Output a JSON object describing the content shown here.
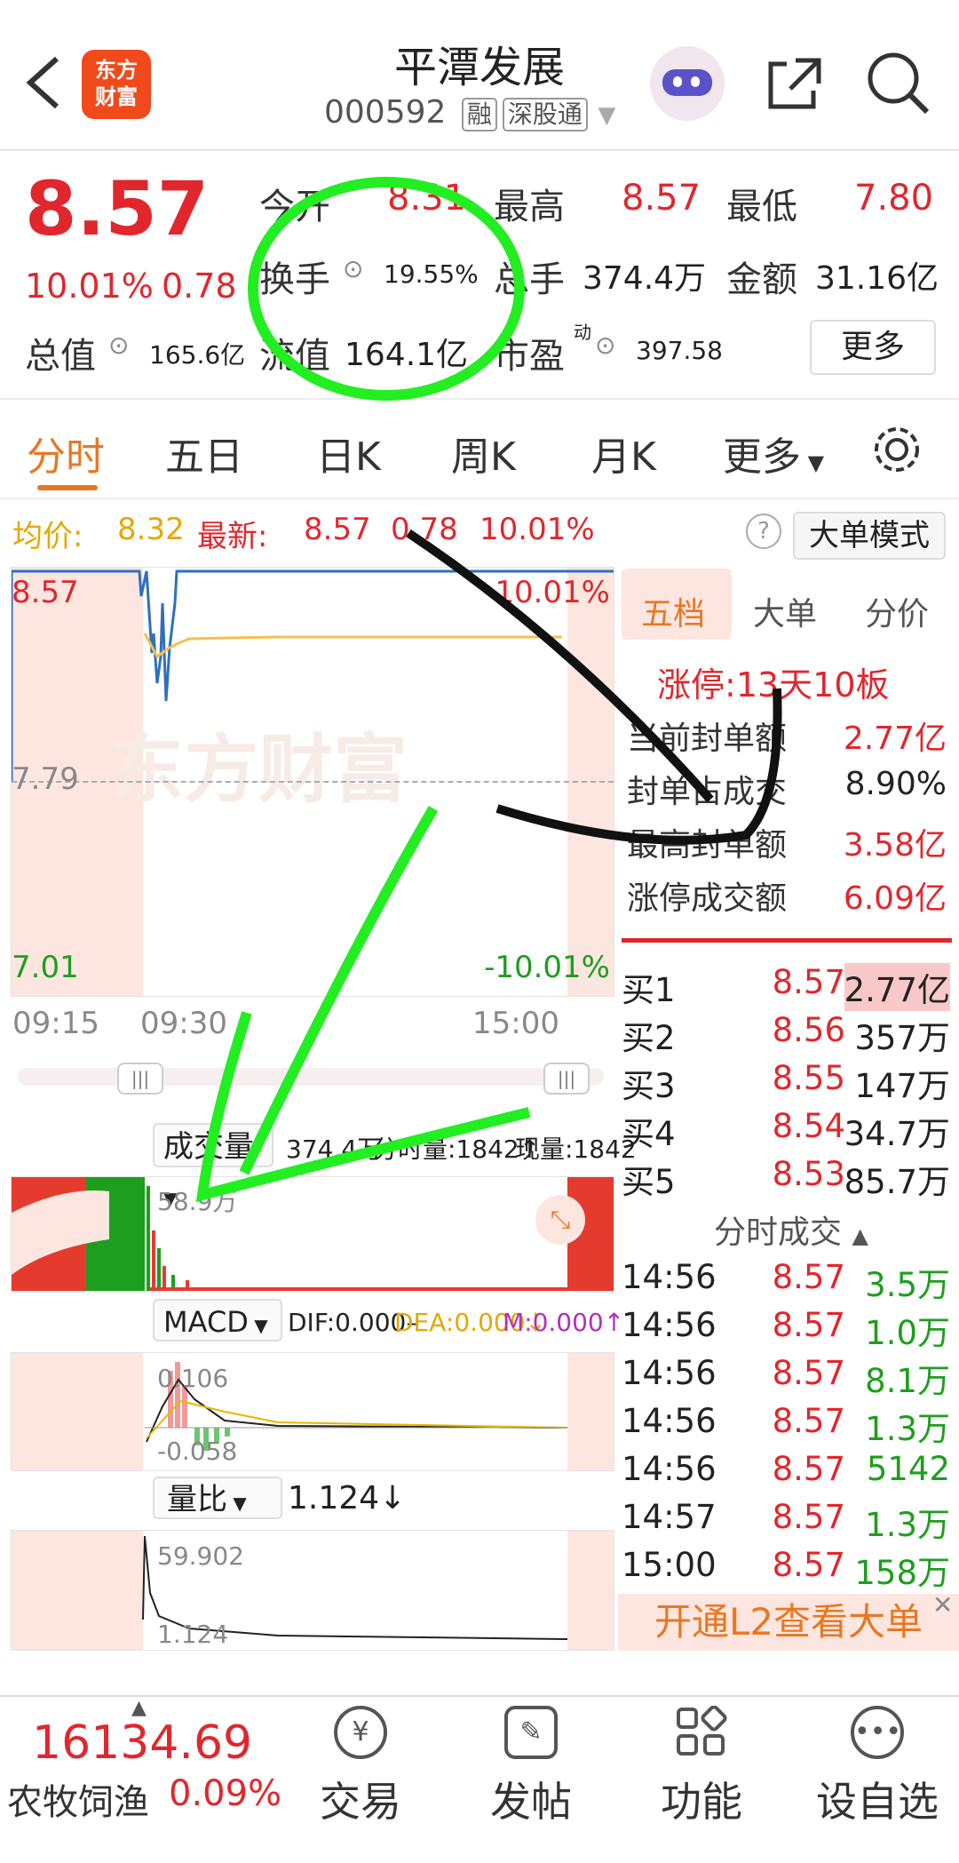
{
  "header": {
    "back_icon": "chevron-left-icon",
    "logo_line1": "东方",
    "logo_line2": "财富",
    "title": "平潭发展",
    "code": "000592",
    "tag1": "融",
    "tag2": "深股通",
    "share_icon": "share-icon",
    "search_icon": "search-icon"
  },
  "quote": {
    "price": "8.57",
    "change_pct": "10.01%",
    "change_amt": "0.78",
    "open_label": "今开",
    "open_val": "8.31",
    "high_label": "最高",
    "high_val": "8.57",
    "low_label": "最低",
    "low_val": "7.80",
    "turnover_label": "换手",
    "turnover_val": "19.55%",
    "volume_label": "总手",
    "volume_val": "374.4万",
    "amount_label": "金额",
    "amount_val": "31.16亿",
    "mktcap_label": "总值",
    "mktcap_val": "165.6亿",
    "float_label": "流值",
    "float_val": "164.1亿",
    "pe_label": "市盈",
    "pe_sup": "动",
    "pe_val": "397.58",
    "more_btn": "更多"
  },
  "tabs": [
    "分时",
    "五日",
    "日K",
    "周K",
    "月K",
    "更多"
  ],
  "infobar": {
    "avg_label": "均价:",
    "avg_val": "8.32",
    "latest_label": "最新:",
    "latest_val": "8.57",
    "chg": "0.78",
    "pct": "10.01%",
    "mode_btn": "大单模式"
  },
  "chart": {
    "y_top": "8.57",
    "y_top_pct": "10.01%",
    "y_mid": "7.79",
    "y_bot": "7.01",
    "y_bot_pct": "-10.01%",
    "x_labels": [
      "09:15",
      "09:30",
      "15:00"
    ],
    "watermark": "东方财富",
    "volume_label": "成交量",
    "volume_total": "374.4万",
    "volume_tick": "分时量:1842↑",
    "volume_now": "现量:1842",
    "volume_max": "58.9万",
    "macd_label": "MACD",
    "macd_dif": "DIF:0.000–",
    "macd_dea": "DEA:0.000↓",
    "macd_m": "M:0.000↑",
    "macd_top": "0.106",
    "macd_bot": "-0.058",
    "ratio_label": "量比",
    "ratio_val": "1.124↓",
    "ratio_top": "59.902",
    "ratio_bot": "1.124"
  },
  "panel": {
    "tabs": [
      "五档",
      "大单",
      "分价"
    ],
    "limit_label": "涨停:",
    "limit_val": "13天10板",
    "rows": [
      {
        "label": "当前封单额",
        "value": "2.77亿"
      },
      {
        "label": "封单占成交",
        "value": "8.90%"
      },
      {
        "label": "最高封单额",
        "value": "3.58亿"
      },
      {
        "label": "涨停成交额",
        "value": "6.09亿"
      }
    ],
    "book": [
      {
        "label": "买1",
        "price": "8.57",
        "vol": "2.77亿"
      },
      {
        "label": "买2",
        "price": "8.56",
        "vol": "357万"
      },
      {
        "label": "买3",
        "price": "8.55",
        "vol": "147万"
      },
      {
        "label": "买4",
        "price": "8.54",
        "vol": "34.7万"
      },
      {
        "label": "买5",
        "price": "8.53",
        "vol": "85.7万"
      }
    ],
    "ticks_title": "分时成交",
    "ticks": [
      {
        "time": "14:56",
        "price": "8.57",
        "vol": "3.5万"
      },
      {
        "time": "14:56",
        "price": "8.57",
        "vol": "1.0万"
      },
      {
        "time": "14:56",
        "price": "8.57",
        "vol": "8.1万"
      },
      {
        "time": "14:56",
        "price": "8.57",
        "vol": "1.3万"
      },
      {
        "time": "14:56",
        "price": "8.57",
        "vol": "5142"
      },
      {
        "time": "14:57",
        "price": "8.57",
        "vol": "1.3万"
      },
      {
        "time": "15:00",
        "price": "8.57",
        "vol": "158万"
      }
    ],
    "l2_banner": "开通L2查看大单"
  },
  "bottom": {
    "index_val": "16134.69",
    "index_name": "农牧饲渔",
    "index_pct": "0.09%",
    "nav": [
      {
        "label": "交易",
        "icon": "yen-exchange-icon"
      },
      {
        "label": "发帖",
        "icon": "edit-icon"
      },
      {
        "label": "功能",
        "icon": "grid-icon"
      },
      {
        "label": "设自选",
        "icon": "more-dots-icon"
      }
    ]
  }
}
